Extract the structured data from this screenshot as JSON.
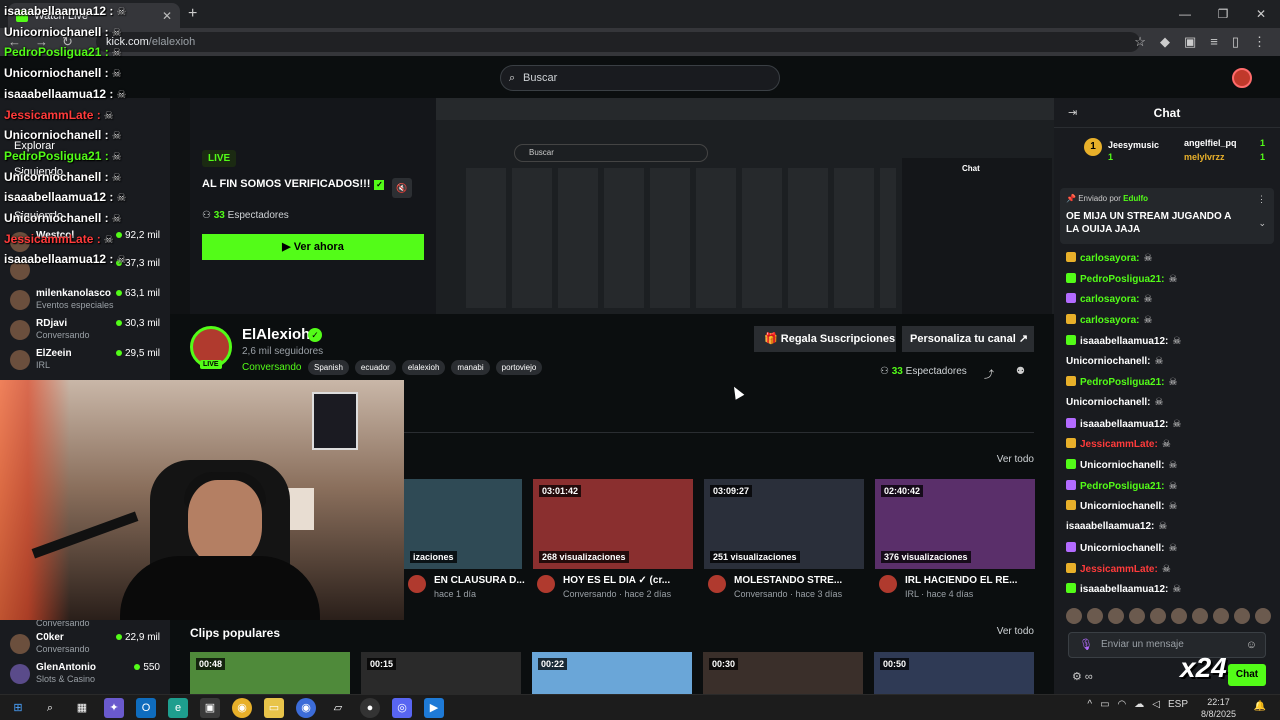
{
  "browser": {
    "tab_title": "Watch Live",
    "url_host": "kick.com",
    "url_path": "/elalexioh"
  },
  "header": {
    "search_placeholder": "Buscar"
  },
  "overlay_chat": [
    {
      "user": "isaaabellaamua12 :",
      "color": "#ffffff"
    },
    {
      "user": "Unicorniochanell :",
      "color": "#ffffff"
    },
    {
      "user": "PedroPosligua21 :",
      "color": "#53fc18"
    },
    {
      "user": "Unicorniochanell :",
      "color": "#ffffff"
    },
    {
      "user": "isaaabellaamua12 :",
      "color": "#ffffff"
    },
    {
      "user": "JessicammLate :",
      "color": "#ff3b3b"
    },
    {
      "user": "Unicorniochanell :",
      "color": "#ffffff"
    },
    {
      "user": "PedroPosligua21 :",
      "color": "#53fc18"
    },
    {
      "user": "Unicorniochanell :",
      "color": "#ffffff"
    },
    {
      "user": "isaaabellaamua12 :",
      "color": "#ffffff"
    },
    {
      "user": "Unicorniochanell :",
      "color": "#ffffff"
    },
    {
      "user": "JessicammLate :",
      "color": "#ff3b3b"
    },
    {
      "user": "isaaabellaamua12 :",
      "color": "#ffffff"
    }
  ],
  "sidebar": {
    "explore": "Explorar",
    "following": "Siguiendo",
    "following2": "Siguiendo",
    "items": [
      {
        "name": "Westcol",
        "category": "",
        "viewers": "92,2 mil"
      },
      {
        "name": "",
        "category": "",
        "viewers": "37,3 mil"
      },
      {
        "name": "milenkanolasco",
        "category": "Eventos especiales",
        "viewers": "63,1 mil"
      },
      {
        "name": "RDjavi",
        "category": "Conversando",
        "viewers": "30,3 mil"
      },
      {
        "name": "ElZeein",
        "category": "IRL",
        "viewers": "29,5 mil"
      },
      {
        "name": "C0ker",
        "category": "Conversando",
        "viewers": "22,9 mil"
      },
      {
        "name": "GlenAntonio",
        "category": "Slots & Casino",
        "viewers": "550"
      }
    ],
    "conversando_top": "Conversando"
  },
  "preview": {
    "live_label": "LIVE",
    "title": "AL FIN SOMOS VERIFICADOS!!!",
    "viewers_count": "33",
    "viewers_label": "Espectadores",
    "watch_button": "Ver ahora",
    "inner_search": "Buscar",
    "inner_chat": "Chat"
  },
  "channel": {
    "name": "ElAlexioh",
    "live_badge": "LIVE",
    "followers": "2,6 mil seguidores",
    "category": "Conversando",
    "tags": [
      "Spanish",
      "ecuador",
      "elalexioh",
      "manabi",
      "portoviejo"
    ],
    "gift_button": "Regala Suscripciones",
    "customize_button": "Personaliza tu canal",
    "spectators_count": "33",
    "spectators_label": "Espectadores"
  },
  "videos": {
    "see_all": "Ver todo",
    "cards": [
      {
        "duration": "",
        "views": "izaciones",
        "title": "EN CLAUSURA D...",
        "meta": "hace 1 día"
      },
      {
        "duration": "03:01:42",
        "views": "268 visualizaciones",
        "title": "HOY ES EL DIA ✓ (cr...",
        "meta": "Conversando · hace 2 días"
      },
      {
        "duration": "03:09:27",
        "views": "251 visualizaciones",
        "title": "MOLESTANDO STRE...",
        "meta": "Conversando · hace 3 días"
      },
      {
        "duration": "02:40:42",
        "views": "376 visualizaciones",
        "title": "IRL HACIENDO EL RE...",
        "meta": "IRL · hace 4 días"
      }
    ]
  },
  "clips": {
    "title": "Clips populares",
    "see_all": "Ver todo",
    "durations": [
      "00:48",
      "00:15",
      "00:22",
      "00:30",
      "00:50"
    ]
  },
  "chat": {
    "title": "Chat",
    "gifters": [
      {
        "name": "Jeesymusic",
        "count": "1"
      },
      {
        "name": "angelfiel_pq",
        "count": "1"
      },
      {
        "name": "melylvrzz",
        "count": "1"
      }
    ],
    "pinned_by_label": "Enviado por",
    "pinned_by_user": "Edulfo",
    "pinned_text": "OE MIJA UN STREAM JUGANDO A LA OUIJA JAJA",
    "messages": [
      {
        "user": "carlosayora:",
        "color": "#53fc18"
      },
      {
        "user": "PedroPosligua21:",
        "color": "#53fc18"
      },
      {
        "user": "carlosayora:",
        "color": "#53fc18"
      },
      {
        "user": "carlosayora:",
        "color": "#53fc18"
      },
      {
        "user": "isaaabellaamua12:",
        "color": "#ffffff"
      },
      {
        "user": "Unicorniochanell:",
        "color": "#ffffff"
      },
      {
        "user": "PedroPosligua21:",
        "color": "#53fc18"
      },
      {
        "user": "Unicorniochanell:",
        "color": "#ffffff"
      },
      {
        "user": "isaaabellaamua12:",
        "color": "#ffffff"
      },
      {
        "user": "JessicammLate:",
        "color": "#ff3b3b"
      },
      {
        "user": "Unicorniochanell:",
        "color": "#ffffff"
      },
      {
        "user": "PedroPosligua21:",
        "color": "#53fc18"
      },
      {
        "user": "Unicorniochanell:",
        "color": "#ffffff"
      },
      {
        "user": "isaaabellaamua12:",
        "color": "#ffffff"
      },
      {
        "user": "Unicorniochanell:",
        "color": "#ffffff"
      },
      {
        "user": "JessicammLate:",
        "color": "#ff3b3b"
      },
      {
        "user": "isaaabellaamua12:",
        "color": "#ffffff"
      }
    ],
    "input_placeholder": "Enviar un mensaje",
    "send_button": "Chat",
    "overlay_logo": "x24"
  },
  "taskbar": {
    "time": "22:17",
    "date": "8/8/2025",
    "lang": "ESP"
  },
  "colors": {
    "accent": "#53fc18",
    "bg": "#0b0e0f",
    "panel": "#191b1f"
  }
}
